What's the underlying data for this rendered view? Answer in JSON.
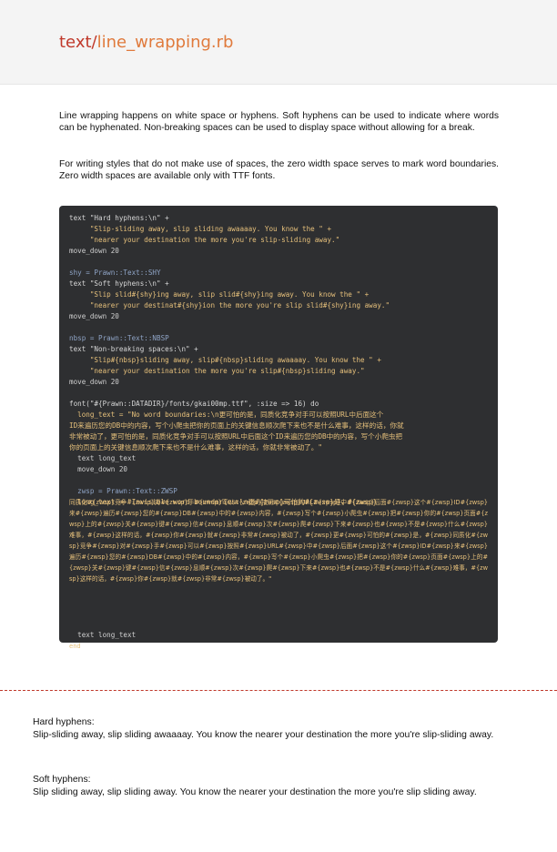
{
  "header": {
    "dir": "text",
    "sep": "/",
    "file": "line_wrapping.rb"
  },
  "intro": {
    "p1": "Line wrapping happens on white space or hyphens. Soft hyphens can be used to indicate where words can be hyphenated. Non-breaking spaces can be used to display space without allowing for a break.",
    "p2": "For writing styles that do not make use of spaces, the zero width space serves to mark word boundaries. Zero width spaces are available only with TTF fonts."
  },
  "code": {
    "l1": "text \"Hard hyphens:\\n\" +",
    "l2": "     \"Slip-sliding away, slip sliding awaaaay. You know the \" +",
    "l3": "     \"nearer your destination the more you're slip-sliding away.\"",
    "l4": "move_down 20",
    "l5": "shy = Prawn::Text::SHY",
    "l6": "text \"Soft hyphens:\\n\" +",
    "l7": "     \"Slip slid#{shy}ing away, slip slid#{shy}ing away. You know the \" +",
    "l8": "     \"nearer your destinat#{shy}ion the more you're slip slid#{shy}ing away.\"",
    "l9": "move_down 20",
    "l10": "nbsp = Prawn::Text::NBSP",
    "l11": "text \"Non-breaking spaces:\\n\" +",
    "l12": "     \"Slip#{nbsp}sliding away, slip#{nbsp}sliding awaaaay. You know the \" +",
    "l13": "     \"nearer your destination the more you're slip#{nbsp}sliding away.\"",
    "l14": "move_down 20",
    "l15": "font(\"#{Prawn::DATADIR}/fonts/gkai00mp.ttf\", :size => 16) do",
    "l16": "  long_text = \"No word boundaries:\\n更可怕的是，同质化竞争对手可以按照URL中后面这个",
    "l17": "ID来遍历您的DB中的内容，写个小爬虫把你的页面上的关键信息顺次爬下来也不是什么难事，这样的话，你就",
    "l18": "非常被动了，更可怕的是，同质化竞争对手可以按照URL中后面这个ID来遍历您的DB中的内容，写个小爬虫把",
    "l19": "你的页面上的关键信息顺次爬下来也不是什么难事，这样的话，你就非常被动了。\"",
    "l20": "  text long_text",
    "l21": "  move_down 20",
    "l22": "  zwsp = Prawn::Text::ZWSP",
    "l23": "  long_text = \"Invisible word boundaries:\\n更#{zwsp}可怕的#{zwsp}是，#{zwsp}",
    "zw": "同质化#{zwsp}竞争#{zwsp}对#{zwsp}手#{zwsp}可以#{zwsp}按照#{zwsp}URL#{zwsp}中#{zwsp}后面#{zwsp}这个#{zwsp}ID#{zwsp}来#{zwsp}遍历#{zwsp}您的#{zwsp}DB#{zwsp}中的#{zwsp}内容，#{zwsp}写个#{zwsp}小爬虫#{zwsp}把#{zwsp}你的#{zwsp}页面#{zwsp}上的#{zwsp}关#{zwsp}键#{zwsp}信#{zwsp}息顺#{zwsp}次#{zwsp}爬#{zwsp}下来#{zwsp}也#{zwsp}不是#{zwsp}什么#{zwsp}难事，#{zwsp}这样的话，#{zwsp}你#{zwsp}就#{zwsp}非常#{zwsp}被动了，#{zwsp}更#{zwsp}可怕的#{zwsp}是，#{zwsp}同质化#{zwsp}竞争#{zwsp}对#{zwsp}手#{zwsp}可以#{zwsp}按照#{zwsp}URL#{zwsp}中#{zwsp}后面#{zwsp}这个#{zwsp}ID#{zwsp}来#{zwsp}遍历#{zwsp}您的#{zwsp}DB#{zwsp}中的#{zwsp}内容，#{zwsp}写个#{zwsp}小爬虫#{zwsp}把#{zwsp}你的#{zwsp}页面#{zwsp}上的#{zwsp}关#{zwsp}键#{zwsp}信#{zwsp}息顺#{zwsp}次#{zwsp}爬#{zwsp}下来#{zwsp}也#{zwsp}不是#{zwsp}什么#{zwsp}难事，#{zwsp}这样的话，#{zwsp}你#{zwsp}就#{zwsp}非常#{zwsp}被动了。\"",
    "l24": "  text long_text",
    "end": "end"
  },
  "output": {
    "h1": "Hard hyphens:",
    "t1": "Slip-sliding away, slip sliding awaaaay. You know the nearer your destination the more you're slip-sliding away.",
    "h2": "Soft hyphens:",
    "t2": "Slip sliding away, slip sliding away. You know the nearer your destination the more you're slip sliding away."
  }
}
